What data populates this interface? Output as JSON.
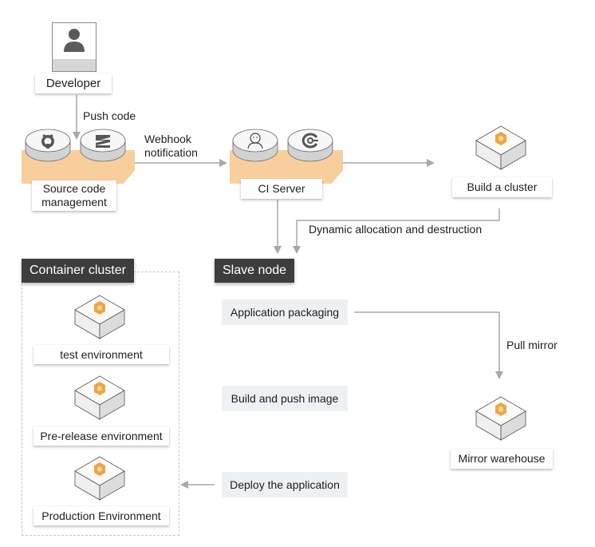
{
  "colors": {
    "accent_orange": "#f5a33c",
    "platform_peach": "#f8cf9c",
    "header_dark": "#3d3d3d",
    "step_bg": "#eef1f3",
    "connector_gray": "#a8a8a8"
  },
  "developer": {
    "label": "Developer",
    "icon": "user-icon"
  },
  "edges": {
    "push_code": "Push code",
    "webhook_line1": "Webhook",
    "webhook_line2": "notification",
    "dynamic": "Dynamic allocation and destruction",
    "pull_mirror": "Pull mirror"
  },
  "source_code": {
    "label_line1": "Source code",
    "label_line2": "management",
    "icons": [
      "github-icon",
      "gitlab-zentao-icon"
    ]
  },
  "ci_server": {
    "label": "CI Server",
    "icons": [
      "jenkins-icon",
      "ci-tool-icon"
    ]
  },
  "build_cluster": {
    "label": "Build a cluster",
    "icon": "cluster-cube-icon"
  },
  "container_cluster": {
    "title": "Container cluster",
    "environments": [
      {
        "label": "test environment"
      },
      {
        "label": "Pre-release environment"
      },
      {
        "label": "Production Environment"
      }
    ]
  },
  "slave_node": {
    "title": "Slave node",
    "steps": [
      {
        "label": "Application packaging"
      },
      {
        "label": "Build and push image"
      },
      {
        "label": "Deploy the application"
      }
    ]
  },
  "mirror_warehouse": {
    "label": "Mirror warehouse",
    "icon": "cluster-cube-icon"
  }
}
